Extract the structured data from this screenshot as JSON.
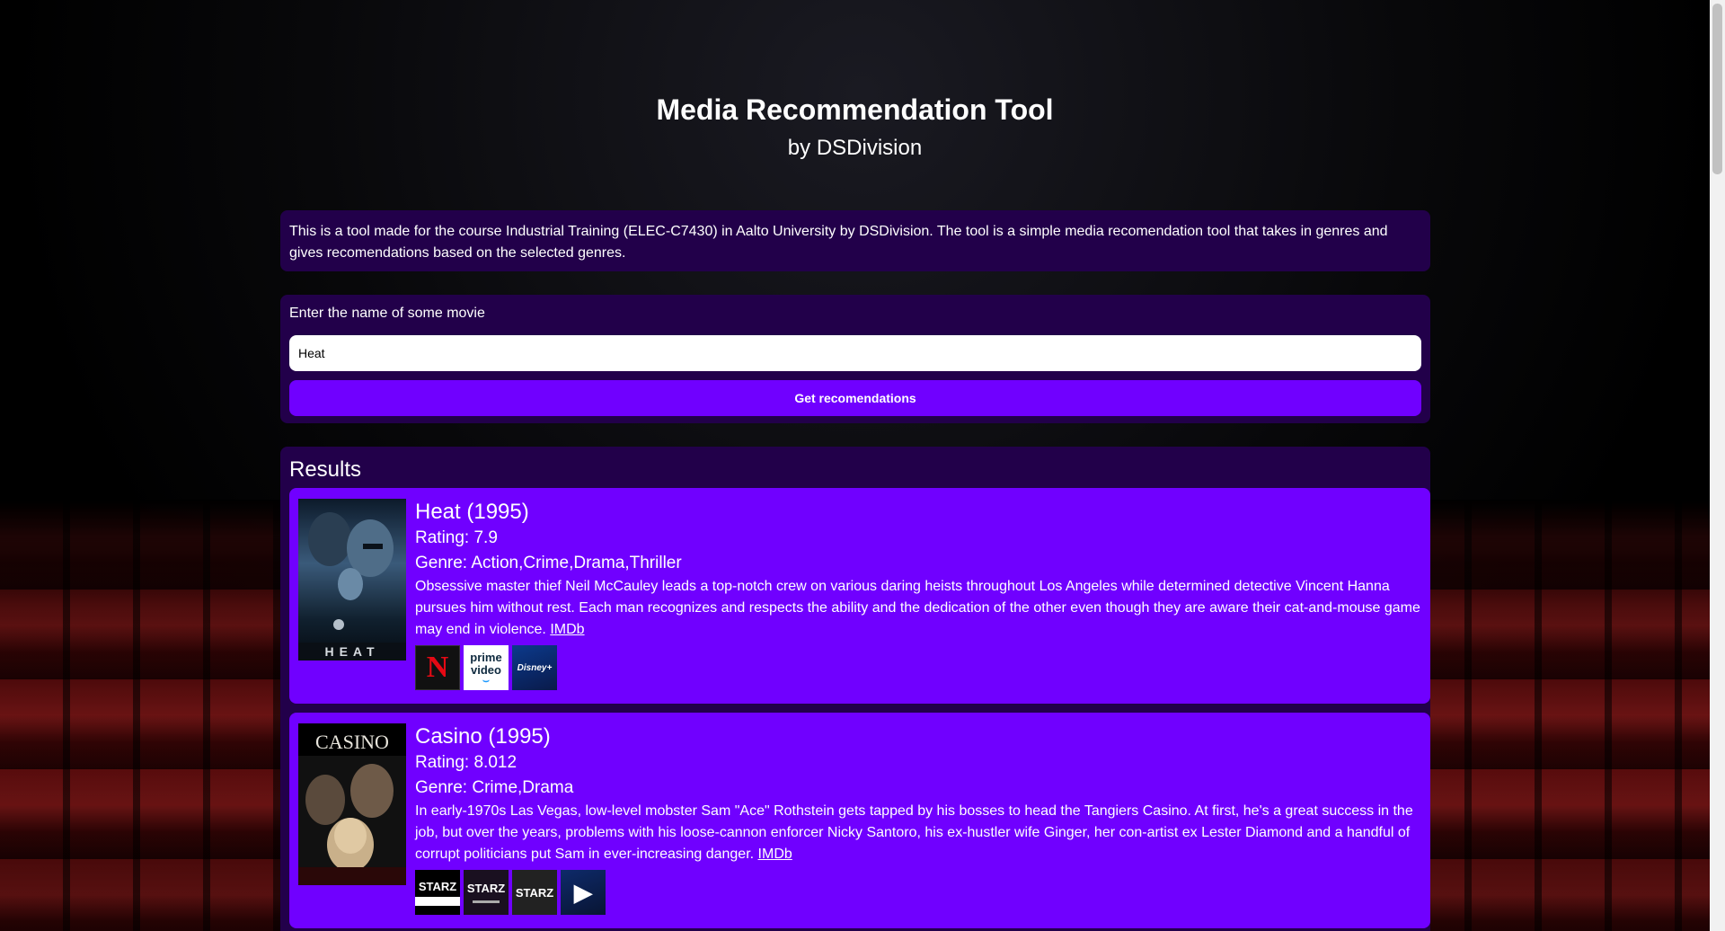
{
  "header": {
    "title": "Media Recommendation Tool",
    "subtitle": "by DSDivision"
  },
  "about": {
    "text": "This is a tool made for the course Industrial Training (ELEC-C7430) in Aalto University by DSDivision. The tool is a simple media recomendation tool that takes in genres and gives recomendations based on the selected genres."
  },
  "form": {
    "label": "Enter the name of some movie",
    "input_value": "Heat",
    "button_label": "Get recomendations"
  },
  "results": {
    "heading": "Results",
    "movies": [
      {
        "title": "Heat (1995)",
        "rating": "Rating: 7.9",
        "genre": "Genre: Action,Crime,Drama,Thriller",
        "description": "Obsessive master thief Neil McCauley leads a top-notch crew on various daring heists throughout Los Angeles while determined detective Vincent Hanna pursues him without rest. Each man recognizes and respects the ability and the dedication of the other even though they are aware their cat-and-mouse game may end in violence.",
        "imdb_label": "IMDb",
        "poster_text": "HEAT",
        "providers": [
          {
            "name": "netflix-logo",
            "label": "N"
          },
          {
            "name": "prime-video-logo",
            "label": "prime video"
          },
          {
            "name": "disney-plus-logo",
            "label": "Disney+"
          }
        ]
      },
      {
        "title": "Casino (1995)",
        "rating": "Rating: 8.012",
        "genre": "Genre: Crime,Drama",
        "description": "In early-1970s Las Vegas, low-level mobster Sam \"Ace\" Rothstein gets tapped by his bosses to head the Tangiers Casino. At first, he's a great success in the job, but over the years, problems with his loose-cannon enforcer Nicky Santoro, his ex-hustler wife Ginger, her con-artist ex Lester Diamond and a handful of corrupt politicians put Sam in ever-increasing danger.",
        "imdb_label": "IMDb",
        "poster_text": "CASINO",
        "providers": [
          {
            "name": "starz-amazon-channel-logo",
            "label": "STARZ"
          },
          {
            "name": "starz-roku-channel-logo",
            "label": "STARZ"
          },
          {
            "name": "starz-logo",
            "label": "STARZ"
          },
          {
            "name": "play-icon",
            "label": "▶"
          }
        ]
      }
    ]
  },
  "colors": {
    "panel": "#22004a",
    "accent": "#7000ff"
  }
}
